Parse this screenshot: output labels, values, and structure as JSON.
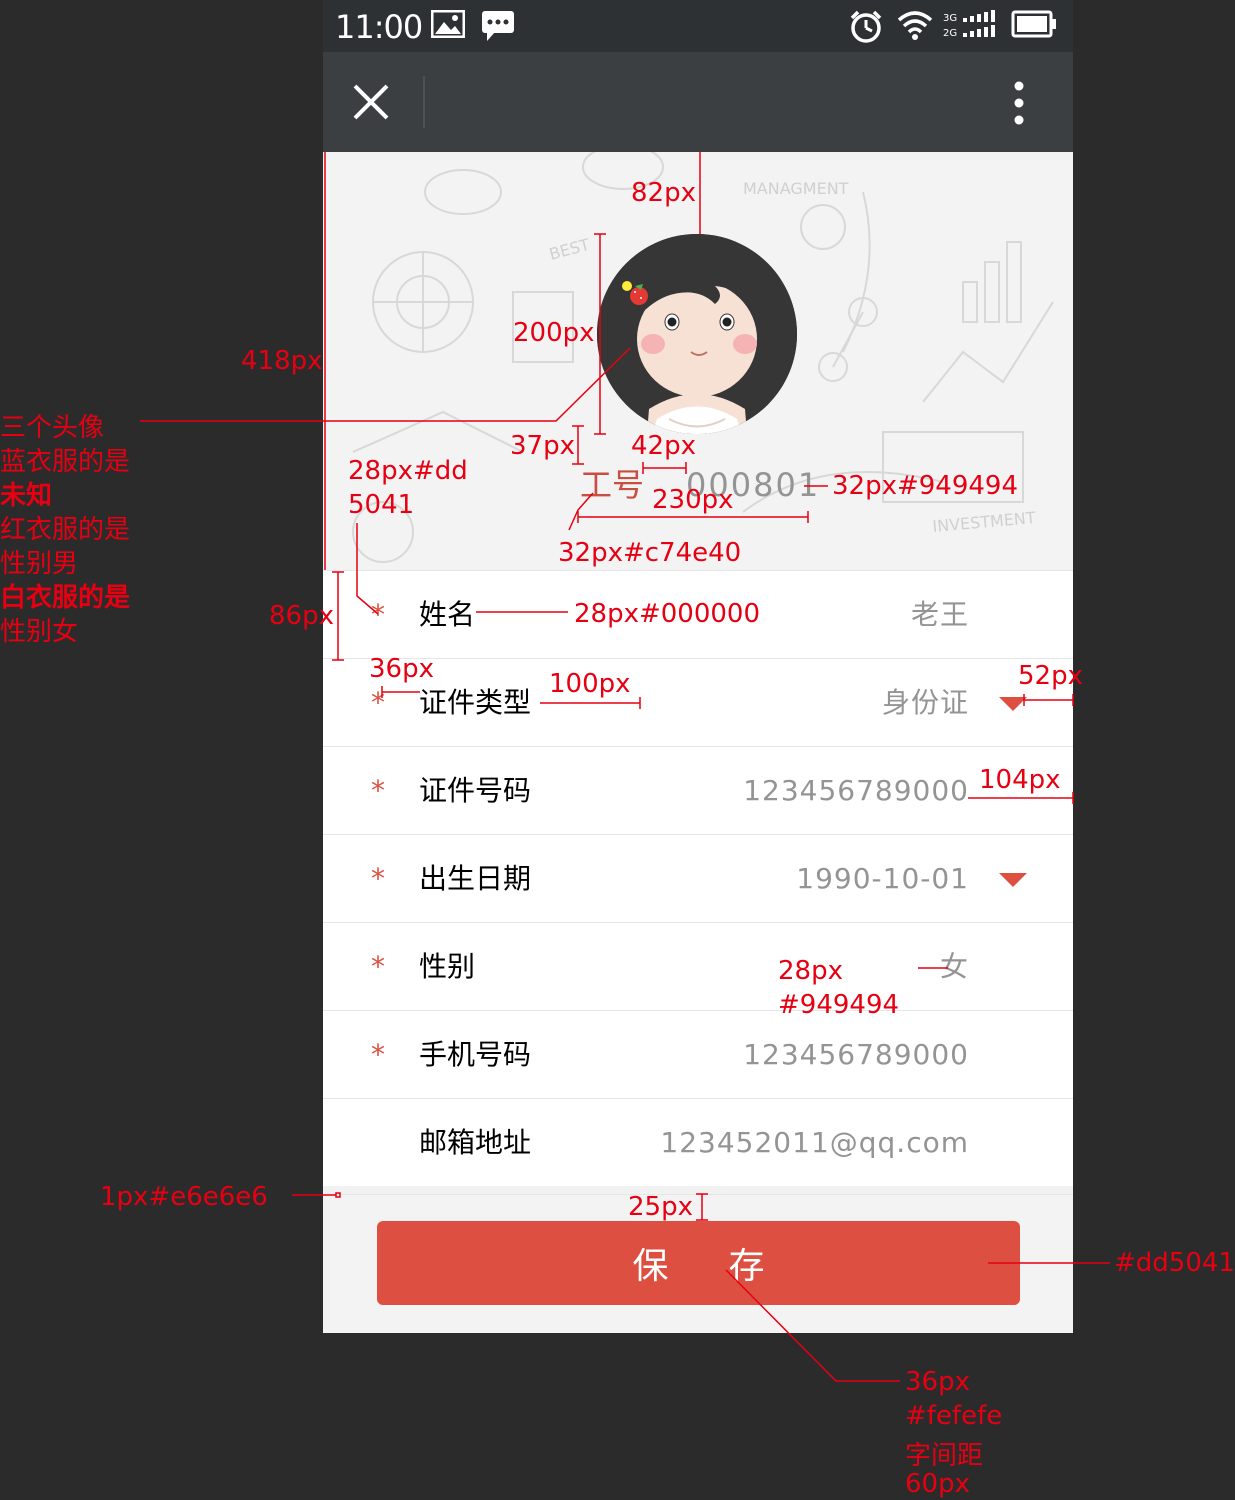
{
  "statusbar": {
    "time": "11:00"
  },
  "navbar": {
    "close_icon": "close-icon",
    "more_icon": "more-vertical-icon"
  },
  "profile": {
    "emp_label": "工号",
    "emp_value": "000801"
  },
  "form": {
    "rows": [
      {
        "label": "姓名",
        "value": "老王",
        "required": true,
        "dropdown": false
      },
      {
        "label": "证件类型",
        "value": "身份证",
        "required": true,
        "dropdown": true
      },
      {
        "label": "证件号码",
        "value": "123456789000",
        "required": true,
        "dropdown": false
      },
      {
        "label": "出生日期",
        "value": "1990-10-01",
        "required": true,
        "dropdown": true
      },
      {
        "label": "性别",
        "value": "女",
        "required": true,
        "dropdown": false
      },
      {
        "label": "手机号码",
        "value": "123456789000",
        "required": true,
        "dropdown": false
      },
      {
        "label": "邮箱地址",
        "value": "123452011@qq.com",
        "required": false,
        "dropdown": false
      }
    ],
    "required_mark": "*"
  },
  "save_button": {
    "label": "保存"
  },
  "annotations": {
    "a82": "82px",
    "a200": "200px",
    "a418": "418px",
    "note1": "三个头像",
    "note2": "蓝衣服的是",
    "note3": "未知",
    "note4": "红衣服的是",
    "note5": "性别男",
    "note6": "白衣服的是",
    "note7": "性别女",
    "a37": "37px",
    "a42": "42px",
    "a28dd_1": "28px#dd",
    "a28dd_2": "5041",
    "a32_949494": "32px#949494",
    "a230": "230px",
    "a32c74e40": "32px#c74e40",
    "a86": "86px",
    "a28_000000": "28px#000000",
    "a36": "36px",
    "a100": "100px",
    "a52": "52px",
    "a104": "104px",
    "a28": "28px",
    "a949494": "#949494",
    "a1px": "1px#e6e6e6",
    "a25": "25px",
    "add5041": "#dd5041",
    "a36b": "36px",
    "afefefe": "#fefefe",
    "aspacing": "字间距",
    "a60": "60px"
  },
  "colors": {
    "accent": "#dd5041",
    "label_red": "#c74e40",
    "value_gray": "#949494",
    "divider": "#e6e6e6",
    "button_text": "#fefefe",
    "annotation": "#e60012"
  }
}
